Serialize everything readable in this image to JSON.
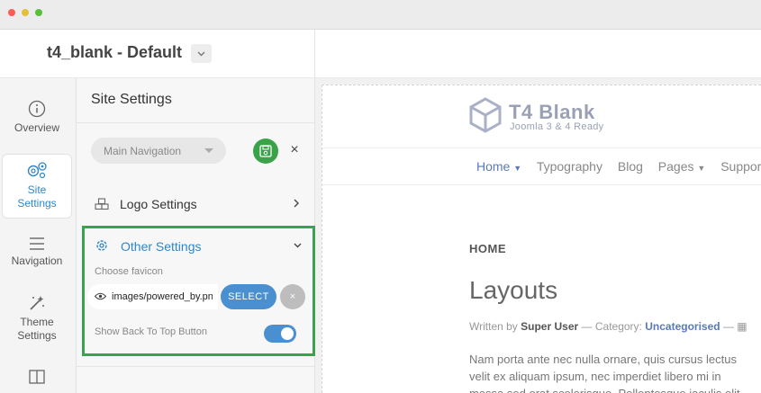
{
  "header": {
    "template_title": "t4_blank - Default"
  },
  "rail": {
    "items": [
      {
        "label": "Overview",
        "icon": "info-icon"
      },
      {
        "label": "Site Settings",
        "icon": "gears-icon",
        "active": true
      },
      {
        "label": "Navigation",
        "icon": "menu-icon"
      },
      {
        "label": "Theme Settings",
        "icon": "magic-wand-icon"
      },
      {
        "label": "",
        "icon": "layout-icon"
      }
    ]
  },
  "panel": {
    "title": "Site Settings",
    "nav_select": "Main Navigation",
    "close_label": "×",
    "logo_settings": "Logo Settings",
    "other_settings": "Other Settings",
    "favicon_label": "Choose favicon",
    "favicon_value": "images/powered_by.png",
    "select_label": "SELECT",
    "clear_label": "×",
    "back_to_top_label": "Show Back To Top Button",
    "back_to_top_on": true
  },
  "preview": {
    "brand_name": "T4 Blank",
    "brand_tagline": "Joomla 3 & 4 Ready",
    "menu": [
      "Home",
      "Typography",
      "Blog",
      "Pages",
      "Support"
    ],
    "breadcrumb": "HOME",
    "article_title": "Layouts",
    "meta": {
      "written_by_label": "Written by",
      "author": "Super User",
      "category_label": "Category:",
      "category": "Uncategorised"
    },
    "body_lines": [
      "Nam porta ante nec nulla ornare, quis cursus lectus",
      "velit ex aliquam ipsum, nec imperdiet libero mi in",
      "massa sed erat scelerisque. Pellentesque iaculis elit"
    ]
  },
  "colors": {
    "accent": "#2f86c8",
    "save_green": "#3aa34a",
    "highlight_border": "#38a44d",
    "select_blue": "#4a8fd0"
  }
}
